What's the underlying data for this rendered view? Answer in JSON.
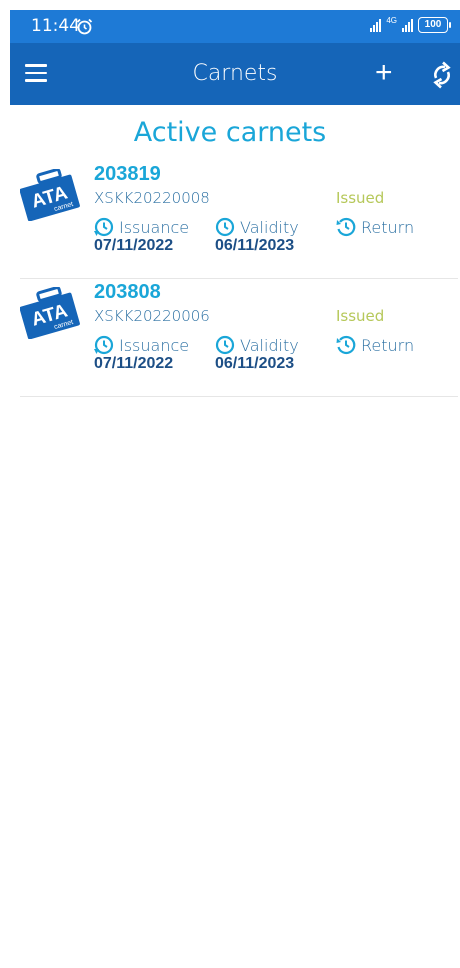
{
  "status_bar": {
    "time": "11:44",
    "network": "4G",
    "battery": "100"
  },
  "app_bar": {
    "title": "Carnets"
  },
  "page": {
    "title": "Active carnets"
  },
  "colors": {
    "accent": "#1aa6d8",
    "appbar": "#1565b8",
    "statusbar": "#1e7ad6",
    "status_issued": "#b6c85a",
    "date_text": "#1d4f86"
  },
  "carnets": [
    {
      "number": "203819",
      "code": "XSKK20220008",
      "status": "Issued",
      "issuance_label": "Issuance",
      "issuance_date": "07/11/2022",
      "validity_label": "Validity",
      "validity_date": "06/11/2023",
      "return_label": "Return",
      "logo_text": "ATA",
      "logo_subtext": "carnet"
    },
    {
      "number": "203808",
      "code": "XSKK20220006",
      "status": "Issued",
      "issuance_label": "Issuance",
      "issuance_date": "07/11/2022",
      "validity_label": "Validity",
      "validity_date": "06/11/2023",
      "return_label": "Return",
      "logo_text": "ATA",
      "logo_subtext": "carnet"
    }
  ]
}
